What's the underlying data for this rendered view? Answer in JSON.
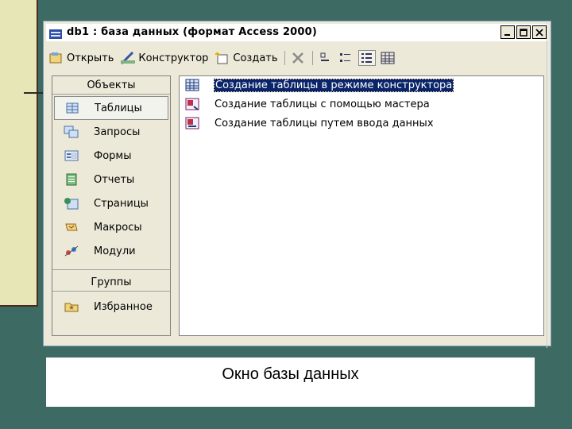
{
  "window": {
    "title": "db1 : база данных (формат Access 2000)"
  },
  "toolbar": {
    "open_label": "Открыть",
    "design_label": "Конструктор",
    "create_label": "Создать"
  },
  "objects_panel": {
    "header": "Объекты",
    "items": [
      {
        "label": "Таблицы",
        "icon": "table-icon"
      },
      {
        "label": "Запросы",
        "icon": "query-icon"
      },
      {
        "label": "Формы",
        "icon": "form-icon"
      },
      {
        "label": "Отчеты",
        "icon": "report-icon"
      },
      {
        "label": "Страницы",
        "icon": "page-icon"
      },
      {
        "label": "Макросы",
        "icon": "macro-icon"
      },
      {
        "label": "Модули",
        "icon": "module-icon"
      }
    ],
    "groups_header": "Группы",
    "favorites_label": "Избранное"
  },
  "list": {
    "items": [
      "Создание таблицы в режиме конструктора",
      "Создание таблицы с помощью мастера",
      "Создание таблицы путем ввода данных"
    ]
  },
  "caption": "Окно базы данных",
  "colors": {
    "slide_background": "#3d6b63",
    "left_panel": "#e6e6b6",
    "selection": "#0a246a"
  }
}
